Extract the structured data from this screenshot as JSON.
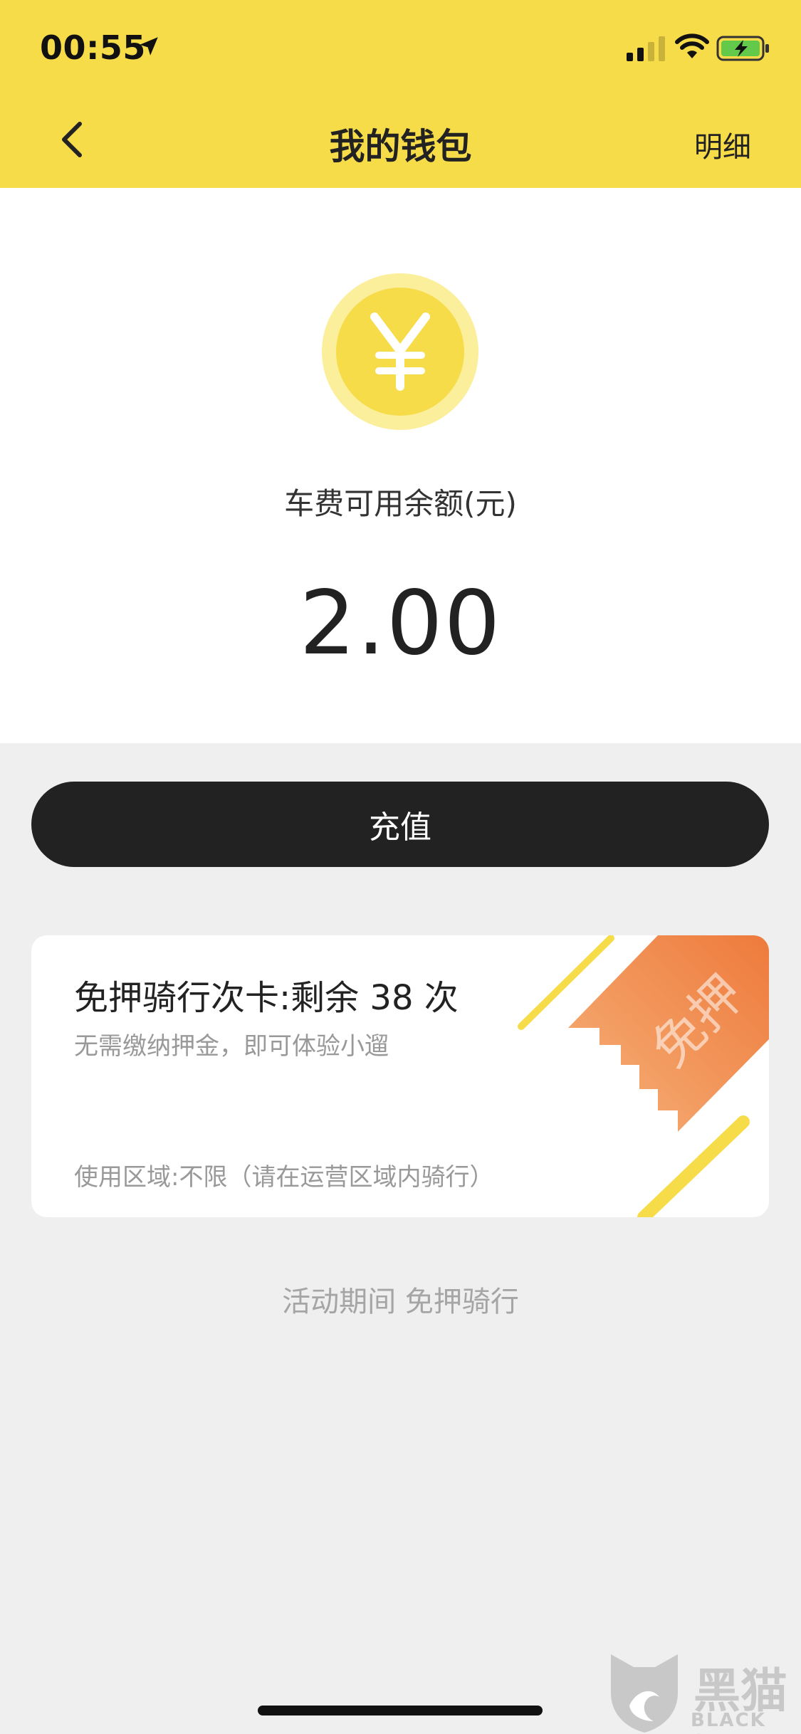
{
  "status_bar": {
    "time": "00:55"
  },
  "header": {
    "title": "我的钱包",
    "detail_label": "明细",
    "background_color": "#f7dc4a"
  },
  "balance": {
    "currency_symbol": "¥",
    "label": "车费可用余额(元)",
    "value": "2.00"
  },
  "actions": {
    "recharge_label": "充值"
  },
  "ride_card": {
    "title": "免押骑行次卡:剩余 38 次",
    "subtitle": "无需缴纳押金，即可体验小遛",
    "area": "使用区域:不限（请在运营区域内骑行）",
    "ribbon_text": "免押",
    "accent_color": "#f08a4b"
  },
  "promo": {
    "text": "活动期间 免押骑行"
  },
  "watermark": {
    "word": "黑猫",
    "sub": "BLACK CAT"
  },
  "icons": [
    "location-arrow-icon",
    "signal-icon",
    "wifi-icon",
    "battery-charging-icon",
    "back-chevron-icon",
    "yuan-coin-icon",
    "black-cat-logo-icon"
  ]
}
